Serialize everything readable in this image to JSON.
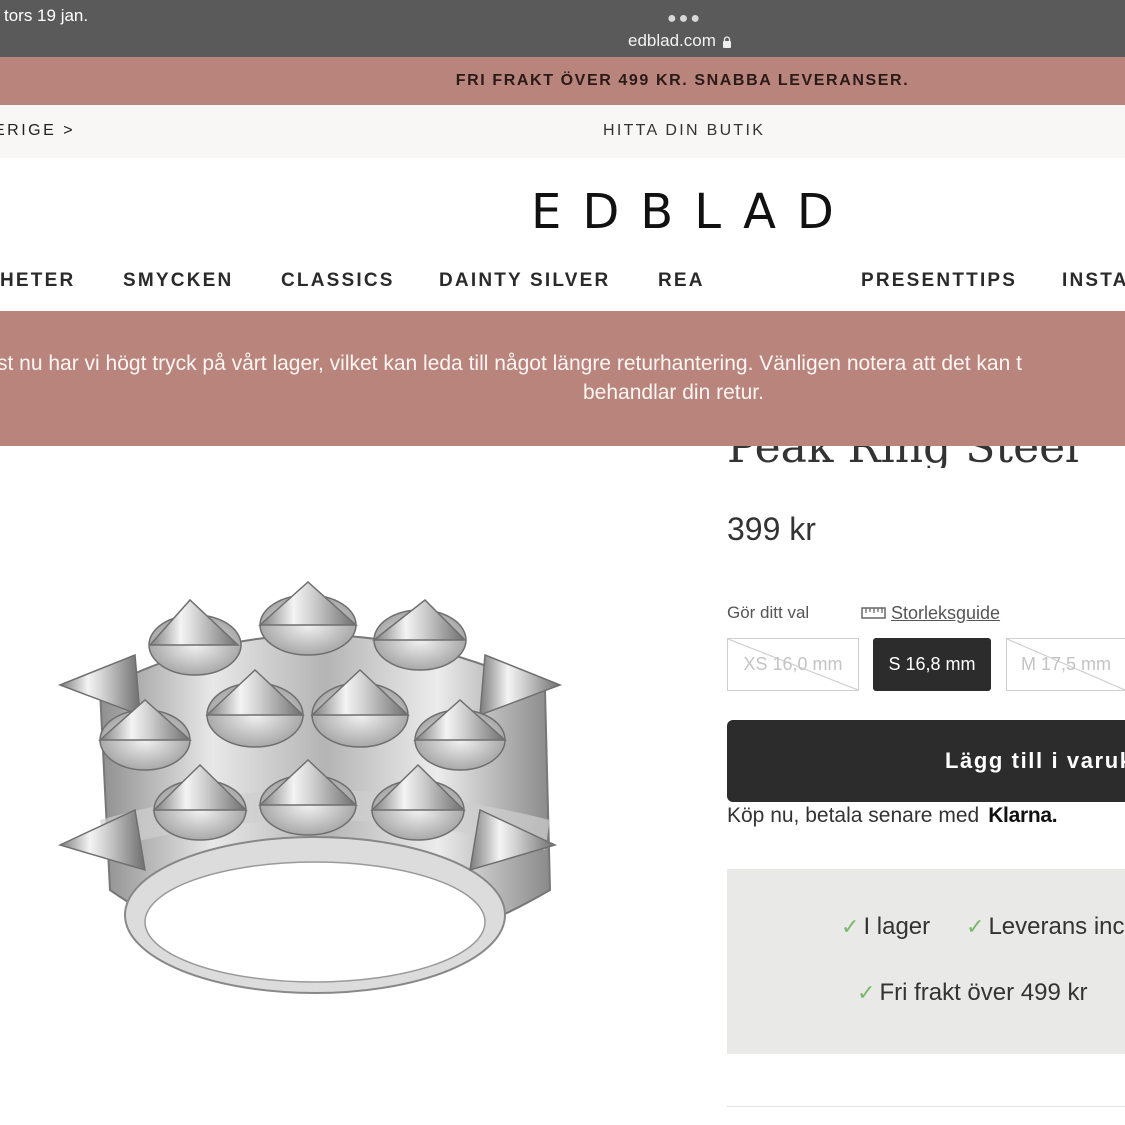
{
  "browser": {
    "date": "tors 19 jan.",
    "url": "edblad.com"
  },
  "promo": {
    "text": "FRI FRAKT ÖVER 499 KR. SNABBA LEVERANSER."
  },
  "store_row": {
    "country": "ERIGE >",
    "find_store": "HITTA DIN BUTIK"
  },
  "logo": "EDBLAD",
  "nav": {
    "items": [
      "HETER",
      "SMYCKEN",
      "CLASSICS",
      "DAINTY SILVER",
      "REA",
      "PRESENTTIPS",
      "INSTA"
    ]
  },
  "notice": {
    "line1": "st nu har vi högt tryck på vårt lager, vilket kan leda till något längre returhantering. Vänligen notera att det kan t",
    "line2": "behandlar din retur."
  },
  "product": {
    "title": "Peak Ring Steel",
    "price": "399 kr",
    "choose_label": "Gör ditt val",
    "size_guide": "Storleksguide",
    "sizes": [
      {
        "label": "XS 16,0 mm",
        "available": false,
        "selected": false
      },
      {
        "label": "S 16,8 mm",
        "available": true,
        "selected": true
      },
      {
        "label": "M 17,5 mm",
        "available": false,
        "selected": false
      }
    ],
    "add_to_cart": "Lägg till i varuk",
    "klarna_text": "Köp nu, betala senare med",
    "klarna_brand": "Klarna."
  },
  "info": {
    "in_stock": "I lager",
    "delivery": "Leverans inc",
    "free_shipping": "Fri frakt över 499 kr"
  },
  "colors": {
    "promo_bg": "#b8847b",
    "dark_button": "#2c2c2c",
    "check_green": "#7bb86e",
    "info_bg": "#e9e9e7"
  }
}
